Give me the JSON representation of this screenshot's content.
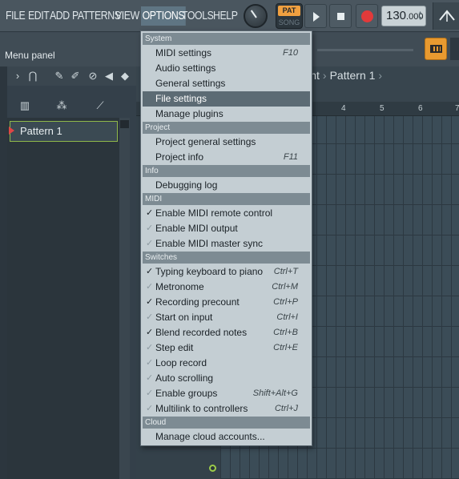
{
  "menubar": {
    "items": [
      "FILE",
      "EDIT",
      "ADD",
      "PATTERNS",
      "VIEW",
      "OPTIONS",
      "TOOLS",
      "HELP"
    ],
    "active": "OPTIONS"
  },
  "transport": {
    "pat_label": "PAT",
    "song_label": "SONG",
    "tempo_int": "130",
    "tempo_dec": ".000"
  },
  "hint": {
    "text": "Menu panel"
  },
  "playlist": {
    "breadcrumb": [
      "ement",
      "Pattern 1"
    ],
    "ruler": [
      "4",
      "5",
      "6",
      "7"
    ]
  },
  "patterns": {
    "items": [
      "Pattern 1"
    ]
  },
  "dropdown": {
    "sections": [
      {
        "header": "System",
        "items": [
          {
            "label": "MIDI settings",
            "shortcut": "F10"
          },
          {
            "label": "Audio settings",
            "shortcut": ""
          },
          {
            "label": "General settings",
            "shortcut": ""
          },
          {
            "label": "File settings",
            "shortcut": "",
            "highlight": true
          },
          {
            "label": "Manage plugins",
            "shortcut": ""
          }
        ]
      },
      {
        "header": "Project",
        "items": [
          {
            "label": "Project general settings",
            "shortcut": ""
          },
          {
            "label": "Project info",
            "shortcut": "F11"
          }
        ]
      },
      {
        "header": "Info",
        "items": [
          {
            "label": "Debugging log",
            "shortcut": ""
          }
        ]
      },
      {
        "header": "MIDI",
        "items": [
          {
            "label": "Enable MIDI remote control",
            "shortcut": "",
            "checked": true
          },
          {
            "label": "Enable MIDI output",
            "shortcut": "",
            "checked": false
          },
          {
            "label": "Enable MIDI master sync",
            "shortcut": "",
            "checked": false
          }
        ]
      },
      {
        "header": "Switches",
        "items": [
          {
            "label": "Typing keyboard to piano",
            "shortcut": "Ctrl+T",
            "checked": true
          },
          {
            "label": "Metronome",
            "shortcut": "Ctrl+M",
            "checked": false
          },
          {
            "label": "Recording precount",
            "shortcut": "Ctrl+P",
            "checked": true
          },
          {
            "label": "Start on input",
            "shortcut": "Ctrl+I",
            "checked": false
          },
          {
            "label": "Blend recorded notes",
            "shortcut": "Ctrl+B",
            "checked": true
          },
          {
            "label": "Step edit",
            "shortcut": "Ctrl+E",
            "checked": false
          },
          {
            "label": "Loop record",
            "shortcut": "",
            "checked": false
          },
          {
            "label": "Auto scrolling",
            "shortcut": "",
            "checked": false
          },
          {
            "label": "Enable groups",
            "shortcut": "Shift+Alt+G",
            "checked": false
          },
          {
            "label": "Multilink to controllers",
            "shortcut": "Ctrl+J",
            "checked": false
          }
        ]
      },
      {
        "header": "Cloud",
        "items": [
          {
            "label": "Manage cloud accounts...",
            "shortcut": ""
          }
        ]
      }
    ]
  }
}
